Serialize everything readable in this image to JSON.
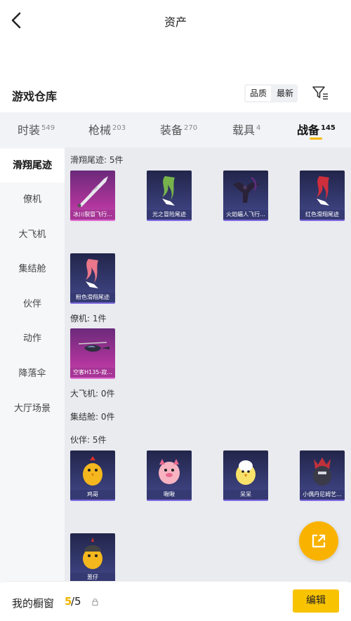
{
  "header": {
    "title": "资产"
  },
  "warehouse": {
    "title": "游戏仓库",
    "sort": [
      {
        "label": "品质",
        "active": true
      },
      {
        "label": "最新",
        "active": false
      }
    ]
  },
  "tabs": [
    {
      "label": "时装",
      "count": "549"
    },
    {
      "label": "枪械",
      "count": "203"
    },
    {
      "label": "装备",
      "count": "270"
    },
    {
      "label": "载具",
      "count": "4"
    },
    {
      "label": "战备",
      "count": "145",
      "active": true
    }
  ],
  "sidebar": [
    "滑翔尾迹",
    "僚机",
    "大飞机",
    "集结舱",
    "伙伴",
    "动作",
    "降落伞",
    "大厅场景"
  ],
  "sections": {
    "glide": {
      "label": "滑翔尾迹: 5件",
      "items": [
        {
          "name": "冰川裂冒飞行...",
          "tone": "pink",
          "art": "blade"
        },
        {
          "name": "光之冒险尾迹",
          "tone": "blue",
          "art": "green-smoke"
        },
        {
          "name": "火焰蝠人飞行...",
          "tone": "blue",
          "art": "bat"
        },
        {
          "name": "红色滑翔尾迹",
          "tone": "blue",
          "art": "red-smoke"
        },
        {
          "name": "粉色滑翔尾迹",
          "tone": "blue",
          "art": "pink-smoke"
        }
      ]
    },
    "wingman": {
      "label": "僚机: 1件",
      "items": [
        {
          "name": "空客H135-寂...",
          "tone": "pink",
          "art": "heli"
        }
      ]
    },
    "plane": {
      "label": "大飞机: 0件"
    },
    "pod": {
      "label": "集结舱: 0件"
    },
    "partner": {
      "label": "伙伴: 5件",
      "items": [
        {
          "name": "鸡哥",
          "tone": "blue",
          "art": "chick-yellow"
        },
        {
          "name": "啾啾",
          "tone": "blue",
          "art": "pig"
        },
        {
          "name": "呆呆",
          "tone": "blue",
          "art": "chick-white"
        },
        {
          "name": "小偶丹尼姆艺...",
          "tone": "blue",
          "art": "knight"
        },
        {
          "name": "葱仔",
          "tone": "blue",
          "art": "chick-helmet"
        }
      ]
    }
  },
  "footer": {
    "label": "我的橱窗",
    "current": "5",
    "total": "/5",
    "edit_label": "编辑"
  },
  "colors": {
    "accent": "#f8c300",
    "fab": "#f9b200",
    "count": "#f0b400"
  }
}
